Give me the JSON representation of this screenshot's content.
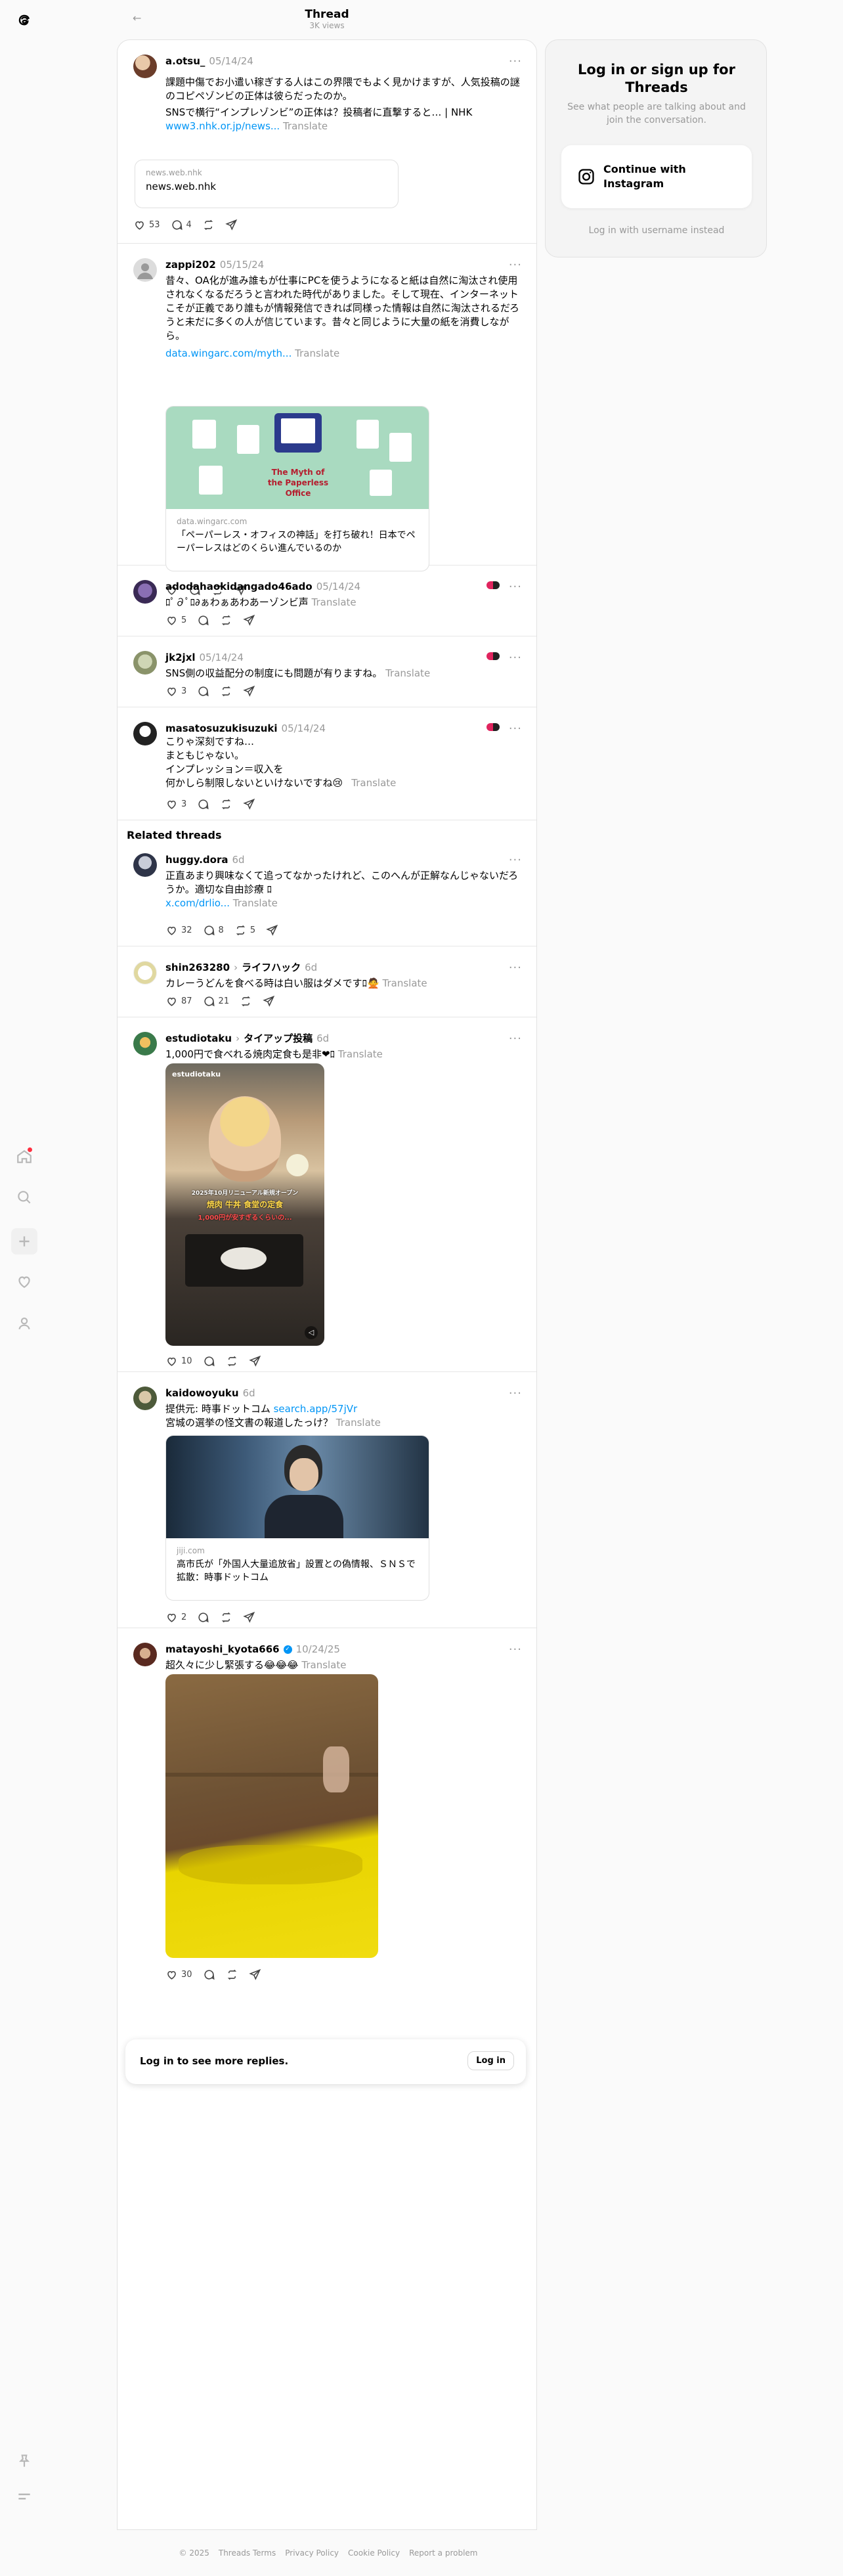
{
  "header": {
    "title": "Thread",
    "views": "3K views",
    "back_icon": "arrow-left-icon"
  },
  "nav": {
    "items": [
      "threads-logo",
      "home-icon",
      "search-icon",
      "create-icon",
      "activity-icon",
      "profile-icon",
      "pin-icon",
      "menu-icon"
    ],
    "badge_color": "#ff3040"
  },
  "posts": [
    {
      "user": "a.otsu_",
      "date": "05/14/24",
      "text": "課題中傷でお小遣い稼ぎする人はこの界隈でもよく見かけますが、人気投稿の謎のコピペゾンビの正体は彼らだったのか。",
      "text2": "SNSで横行“インプレゾンビ”の正体は？投稿者に直撃すると… | NHK",
      "link": "www3.nhk.or.jp/news...",
      "translate": "Translate",
      "card": {
        "domain": "news.web.nhk",
        "title": "news.web.nhk"
      },
      "likes": "53",
      "replies": "4"
    },
    {
      "user": "zappi202",
      "date": "05/15/24",
      "text": "昔々、OA化が進み誰もが仕事にPCを使うようになると紙は自然に淘汰され使用されなくなるだろうと言われた時代がありました。そして現在、インターネットこそが正義であり誰もが情報発信できれば同様った情報は自然に淘汰されるだろうと未だに多くの人が信じています。昔々と同じように大量の紙を消費しながら。",
      "link": "data.wingarc.com/myth...",
      "translate": "Translate",
      "image_title_line1": "The Myth of",
      "image_title_line2": "the Paperless Office",
      "card": {
        "domain": "data.wingarc.com",
        "title": "「ペーパーレス・オフィスの神話」を打ち破れ！日本でペーパーレスはどのくらい進んでいるのか"
      }
    },
    {
      "user": "adodahaokidangado46ado",
      "date": "05/14/24",
      "text": "ﾛﾟ∂ﾟﾛ∂ぁわぁあわあーゾンビ声",
      "translate": "Translate",
      "likes": "5"
    },
    {
      "user": "jk2jxl",
      "date": "05/14/24",
      "text": "SNS側の収益配分の制度にも問題が有りますね。",
      "translate": "Translate",
      "likes": "3"
    },
    {
      "user": "masatosuzukisuzuki",
      "date": "05/14/24",
      "text": "こりゃ深刻ですね…\nまともじゃない。\nインプレッション＝収入を\n何かしら制限しないといけないですね😢",
      "translate": "Translate",
      "likes": "3"
    }
  ],
  "related_heading": "Related threads",
  "related": [
    {
      "user": "huggy.dora",
      "date": "6d",
      "text": "正直あまり興味なくて追ってなかったけれど、このへんが正解なんじゃないだろうか。適切な自由診療 ﾛ",
      "link": "x.com/drlio...",
      "translate": "Translate",
      "likes": "32",
      "replies": "8",
      "reposts": "5"
    },
    {
      "user": "shin263280",
      "topic": "ライフハック",
      "date": "6d",
      "text": "カレーうどんを食べる時は白い服はダメですﾛ🙅",
      "translate": "Translate",
      "likes": "87",
      "replies": "21"
    },
    {
      "user": "estudiotaku",
      "topic": "タイアップ投稿",
      "date": "6d",
      "text": "1,000円で食べれる焼肉定食も是非❤ﾛ",
      "translate": "Translate",
      "video_tag": "estudiotaku",
      "video_caption1": "2025年10月リニューアル新規オープン",
      "video_caption2": "焼肉 牛丼 食堂の定食",
      "video_caption3": "1,000円が安すぎるくらいの...",
      "likes": "10"
    },
    {
      "user": "kaidowoyuku",
      "date": "6d",
      "text": "提供元: 時事ドットコム",
      "link": "search.app/57jVr",
      "text2": "宮城の選挙の怪文書の報道したっけ？",
      "translate": "Translate",
      "card": {
        "domain": "jiji.com",
        "title": "高市氏が「外国人大量追放省」設置との偽情報、ＳＮＳで拡散：時事ドットコム"
      },
      "likes": "2"
    },
    {
      "user": "matayoshi_kyota666",
      "verified_color": "#0095f6",
      "date": "10/24/25",
      "text": "超久々に少し緊張する😂😂😂",
      "translate": "Translate",
      "likes": "30"
    }
  ],
  "login_prompt": {
    "text": "Log in to see more replies.",
    "button": "Log in"
  },
  "sidebar": {
    "title": "Log in or sign up for Threads",
    "desc": "See what people are talking about and join the conversation.",
    "ig_button": "Continue with Instagram",
    "alt": "Log in with username instead"
  },
  "footer": {
    "links": [
      "© 2025",
      "Threads Terms",
      "Privacy Policy",
      "Cookie Policy",
      "Report a problem"
    ]
  }
}
